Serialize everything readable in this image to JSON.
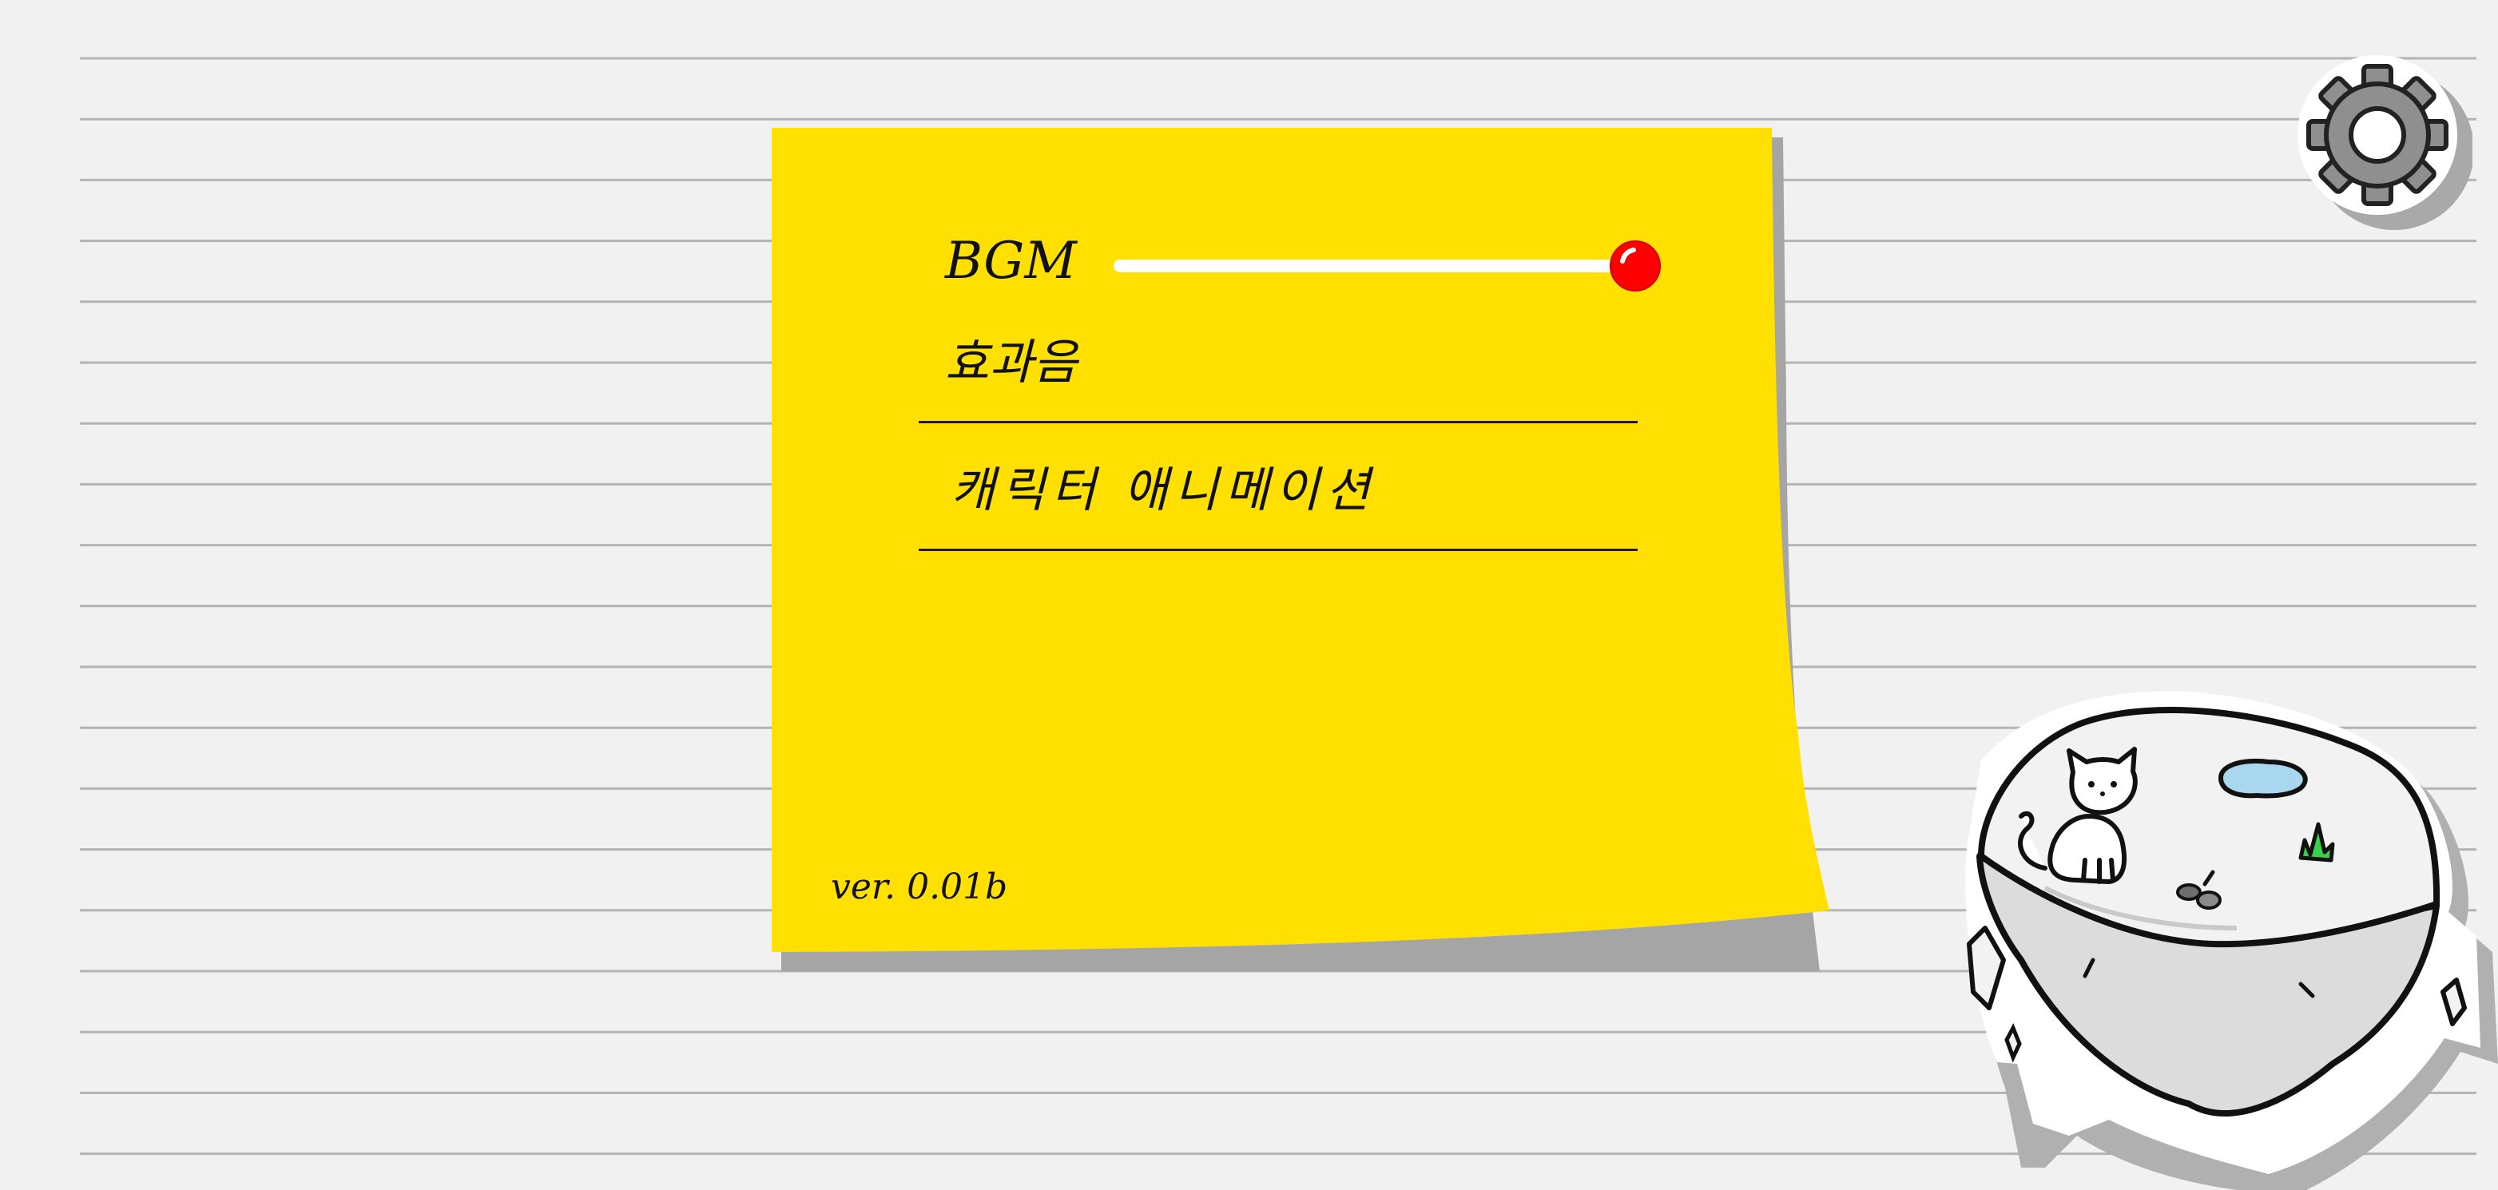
{
  "options": {
    "bgm_label": "BGM",
    "bgm_volume": 1.0,
    "sfx_label": "효과음",
    "character_animation_label": "캐릭터 애니메이션"
  },
  "version": "ver. 0.01b",
  "colors": {
    "background": "#f1f1f1",
    "note": "#ffe000",
    "slider_thumb": "#ff0000",
    "slider_track": "#ffffff"
  },
  "icons": {
    "settings": "gear-icon",
    "illustration": "floating-island-with-cat"
  }
}
